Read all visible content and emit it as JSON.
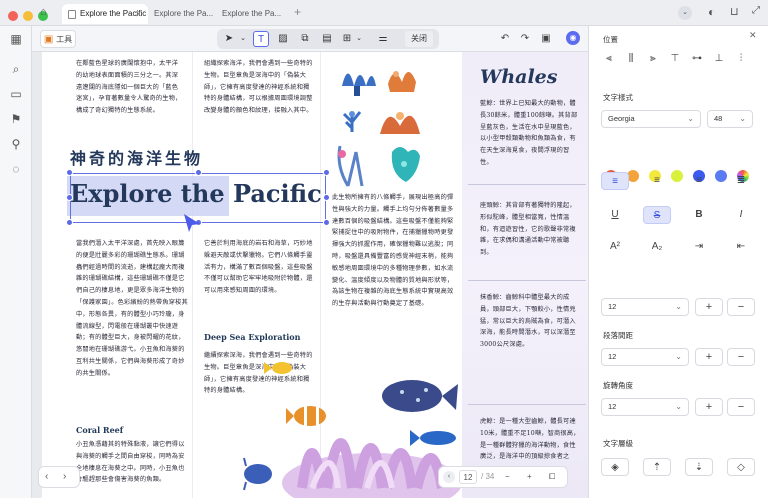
{
  "tabs": [
    {
      "label": "Explore the Pacific",
      "active": true
    },
    {
      "label": "Explore the Pa...",
      "active": false
    },
    {
      "label": "Explore the Pa...",
      "active": false
    }
  ],
  "toolbar": {
    "mode_label": "工具",
    "close_label": "关闭"
  },
  "page": {
    "title_cn": "神奇的海洋生物",
    "title_en": "Explore the Pacific",
    "col1_top": "在鄰藍色星球的廣闊懷抱中，太平洋的幼地球表面面積的三分之一。其深遠遼闊的海底隱如一個巨大的「藍色迷宮」，孕育著數量令人驚奇的生物，構成了奇幻獨特的生態系統。",
    "col1_bottom": "當我們潛入太平洋深處，首先映入眼簾的便是壯麗多彩的珊瑚礁生態系。珊瑚蟲們經過時間的流逝，建構起龐大而複雜的珊瑚礁結構，這些珊瑚礁不僅是它們自己的棲息地，更是眾多海洋生物的「保護家園」。色彩繽紛的熱帶魚穿梭其中，形態各異，有的體型小巧玲瓏，身體流線型，閃電般在珊瑚叢中快速遊動；有的體型巨大，身被閃耀的花紋，悠閒地在珊瑚礁游弋。小丑魚和海葵的互利共生關係，它們與海葵形成了奇妙的共生關係。",
    "coral_heading": "Coral Reef",
    "col1_coral": "小丑魚憑藉其的特殊黏液，讓它們得以與海葵的觸手之間自由穿梭，同時為安全地棲息在海葵之中。同時，小丑魚也會驅趕那些會傷害海葵的魚類。",
    "col2_top": "組織探索海洋，我們會遇到一些奇特的生物。巨型章魚是深海中的「偽裝大師」，它擁有高度發達的神經系統和獨特的身體結構，可以根據周圍環境調整改變身體的顏色和紋理，接融入其中。",
    "col2_mid": "它善於利用海底的岩石和海草，巧妙地躲避天敵或伏擊獵物。它們八條觸手靈活有力，構滿了數百個吸盤，這些吸盤不僅可以幫助它牢牢地吸附於物體，還可以用來感知周圍的環境。",
    "deep_heading": "Deep Sea Exploration",
    "col2_deep": "繼續探索深海，我們會遇到一些奇特的生物。巨型章魚是深海中的「偽裝大師」，它擁有高度發達的神經系統和獨特的身體結構。",
    "col3_mid": "此生物所擁有的八條觸手，展現出極高的彈性與強大的力量。觸手上均勻分佈著數量多達數百個的吸盤結構。這些吸盤不僅能夠緊緊捕捉住中的吸附物件，在捕獵獵物時更發揮強大的抓握作用，確保獵物難以逃脫；同時，吸盤還具備豐富的感覺神經末梢，能夠敏感地周圍環境中的多種物理參數，如水流變化、溫度傾度以及物體的質地與形狀等，為該生物在複雜的海底生態系統中實現高效的生存與活動與行動奠定了基礎。",
    "whales_title": "Whales",
    "whale_1": "藍鯨：世界上已知最大的動物，體長30餘米，體重100餘噸。其背部呈藍灰色，生活在水中呈現藍色，以小型甲殼類動物和魚類為食，有在天生深海覓食，夜間浮現的習性。",
    "whale_2": "座頭鯨：其背部有著獨特的隆起，形似駝峰，體型相當寬，性情溫和，有迴遊習性，它的歌聲非常複雜，在求偶和溝通活動中常被聽到。",
    "whale_3": "抹香鯨：齒鯨科中體型最大的成員，頭部巨大，下顎較小，性情兇猛，常以巨大的烏賊為食，可潛入深海，能長時間潛水，可以深潛至3000公尺深處。",
    "whale_4": "虎鯨：是一種大型齒鯨，體長可達10米，體重不足10噸，智商很高，是一種群體狩獵的海洋動物，食性廣泛，是海洋中的頂級掠食者之一。"
  },
  "pager": {
    "current": "12",
    "total": "/ 34"
  },
  "right_panel": {
    "position_label": "位置",
    "text_style_label": "文字樣式",
    "font_name": "Georgia",
    "font_size": "48",
    "swatches": [
      "#f05a3c",
      "#f4a23a",
      "#f2e93c",
      "#d9f03c",
      "#3a5af0",
      "#5b7cf0",
      "#c85af0"
    ],
    "spacing_value": "12",
    "paragraph_label": "段落間距",
    "paragraph_value": "12",
    "rotation_label": "旋轉角度",
    "rotation_value": "12",
    "layer_label": "文字層級"
  }
}
